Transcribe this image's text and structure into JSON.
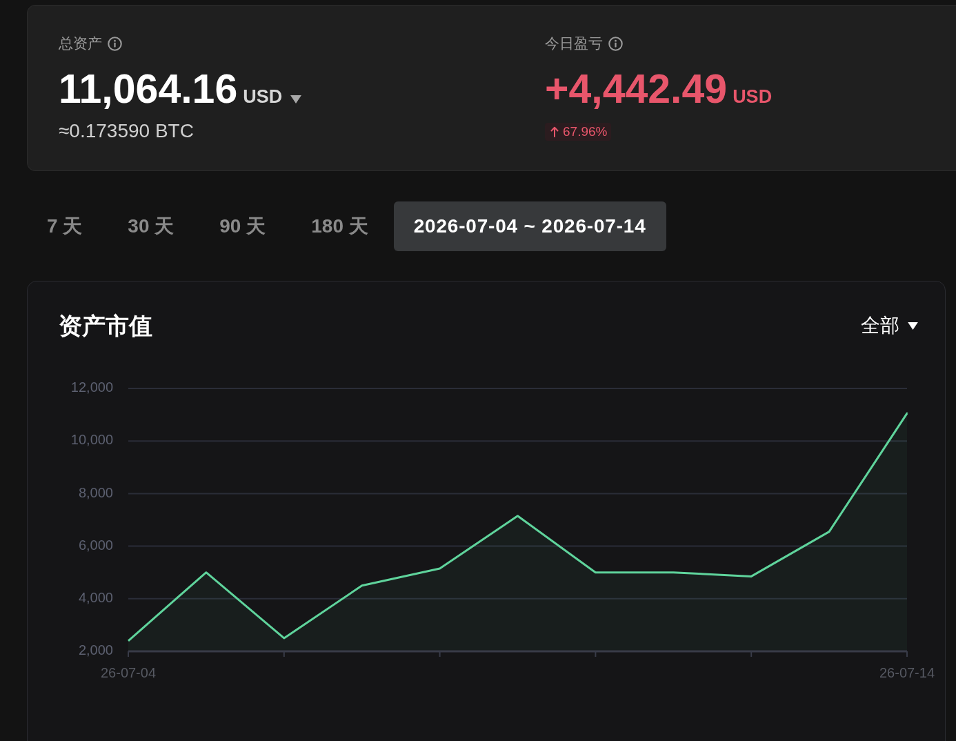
{
  "total_assets": {
    "label": "总资产",
    "amount": "11,064.16",
    "currency": "USD",
    "btc_equivalent": "≈0.173590 BTC"
  },
  "today_pnl": {
    "label": "今日盈亏",
    "amount": "+4,442.49",
    "currency": "USD",
    "change_percent": "67.96%"
  },
  "range_tabs": [
    {
      "label": "7 天",
      "selected": false
    },
    {
      "label": "30 天",
      "selected": false
    },
    {
      "label": "90 天",
      "selected": false
    },
    {
      "label": "180 天",
      "selected": false
    },
    {
      "label": "2026-07-04 ~ 2026-07-14",
      "selected": true
    }
  ],
  "asset_chart": {
    "title": "资产市值",
    "filter": {
      "label": "全部"
    },
    "chart_data": {
      "type": "area",
      "grid": true,
      "categories": [
        "26-07-04",
        null,
        null,
        null,
        null,
        null,
        null,
        null,
        null,
        null,
        "26-07-14"
      ],
      "series": [
        {
          "color": "#5fd49c",
          "values": [
            2400,
            5000,
            2500,
            4500,
            5150,
            7150,
            5000,
            5000,
            4850,
            6550,
            11050
          ]
        }
      ],
      "ylim": [
        2000,
        12000
      ],
      "yticks": [
        {
          "value": 2000,
          "label": "2,000"
        },
        {
          "value": 4000,
          "label": "4,000"
        },
        {
          "value": 6000,
          "label": "6,000"
        },
        {
          "value": 8000,
          "label": "8,000"
        },
        {
          "value": 10000,
          "label": "10,000"
        },
        {
          "value": 12000,
          "label": "12,000"
        }
      ]
    }
  }
}
